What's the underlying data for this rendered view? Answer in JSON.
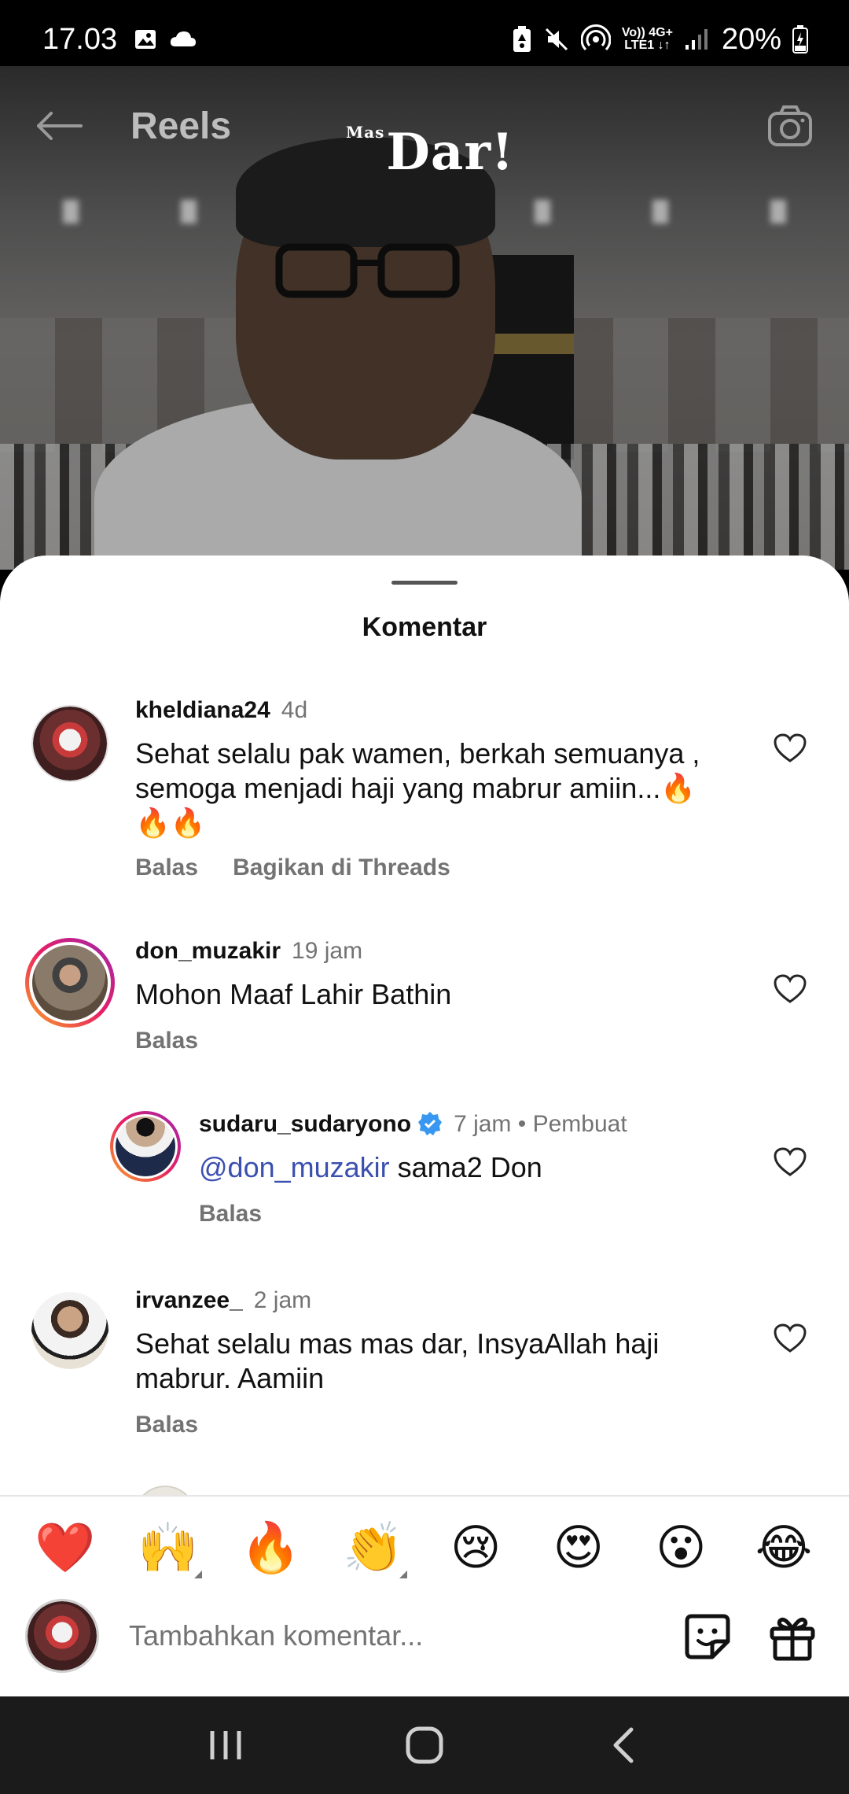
{
  "status_bar": {
    "time": "17.03",
    "network_top": "Vo)) 4G+",
    "network_bottom": "LTE1 ↓↑",
    "battery": "20%"
  },
  "video": {
    "watermark_small": "Mas",
    "watermark": "Dar!"
  },
  "top_bar": {
    "title": "Reels"
  },
  "sheet": {
    "title": "Komentar"
  },
  "comments": [
    {
      "username": "kheldiana24",
      "time": "4d",
      "text_line1": "Sehat selalu pak wamen, berkah semuanya ,",
      "text_line2": "semoga menjadi haji yang mabrur amiin...🔥",
      "text_line3": "🔥🔥",
      "reply": "Balas",
      "share": "Bagikan di Threads"
    },
    {
      "username": "don_muzakir",
      "time": "19 jam",
      "text": "Mohon Maaf Lahir Bathin",
      "reply": "Balas"
    },
    {
      "username": "sudaru_sudaryono",
      "time": "7 jam",
      "author_label": "Pembuat",
      "mention": "@don_muzakir",
      "text": " sama2 Don",
      "reply": "Balas"
    },
    {
      "username": "irvanzee_",
      "time": "2 jam",
      "text_line1": "Sehat selalu mas mas dar, InsyaAllah haji",
      "text_line2": "mabrur. Aamiin",
      "reply": "Balas"
    }
  ],
  "emojis": [
    "❤️",
    "🙌",
    "🔥",
    "👏",
    "😢",
    "😍",
    "😮",
    "😂"
  ],
  "composer": {
    "placeholder": "Tambahkan komentar..."
  },
  "colors": {
    "accent_mention": "#3a4fb0",
    "verified_blue": "#3897f0",
    "muted_text": "#737373",
    "sheet_bg": "#ffffff"
  }
}
